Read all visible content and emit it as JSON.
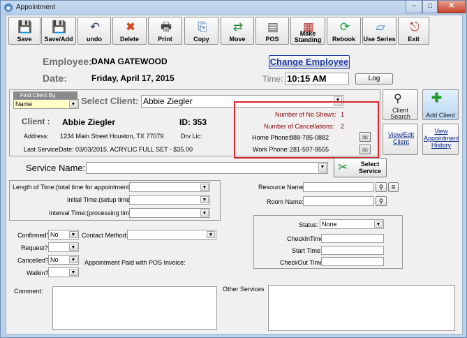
{
  "window": {
    "title": "Appointment"
  },
  "toolbar": [
    {
      "id": "save",
      "label": "Save",
      "icon": "floppy-icon",
      "glyph": "💾"
    },
    {
      "id": "save-add",
      "label": "Save/Add",
      "icon": "floppy-icon",
      "glyph": "💾"
    },
    {
      "id": "undo",
      "label": "undo",
      "icon": "undo-icon",
      "glyph": "↶"
    },
    {
      "id": "delete",
      "label": "Delete",
      "icon": "x-icon",
      "glyph": "✖"
    },
    {
      "id": "print",
      "label": "Print",
      "icon": "printer-icon",
      "glyph": "🖶"
    },
    {
      "id": "copy",
      "label": "Copy",
      "icon": "copy-icon",
      "glyph": "⎘"
    },
    {
      "id": "move",
      "label": "Move",
      "icon": "move-icon",
      "glyph": "⇄"
    },
    {
      "id": "pos",
      "label": "POS",
      "icon": "register-icon",
      "glyph": "▤"
    },
    {
      "id": "make-standing",
      "label": "Make Standing",
      "icon": "calendar-icon",
      "glyph": "▦"
    },
    {
      "id": "rebook",
      "label": "Rebook",
      "icon": "rebook-icon",
      "glyph": "⟳"
    },
    {
      "id": "use-series",
      "label": "Use Series",
      "icon": "series-icon",
      "glyph": "▱"
    },
    {
      "id": "exit",
      "label": "Exit",
      "icon": "exit-icon",
      "glyph": "⎋"
    }
  ],
  "header": {
    "employee_label": "Employee:",
    "employee_value": "DANA GATEWOOD",
    "date_label": "Date:",
    "date_value": "Friday, April 17, 2015",
    "change_employee": "Change Employee",
    "time_label": "Time:",
    "time_value": "10:15 AM",
    "log_label": "Log"
  },
  "client": {
    "find_by_label": "Find Client By:",
    "find_by_value": "Name",
    "select_client_label": "Select Client:",
    "select_client_value": "Abbie Ziegler",
    "client_label": "Client :",
    "client_name": "Abbie Ziegler",
    "id_label": "ID:",
    "id_value": "353",
    "address_label": "Address:",
    "address_value": "1234 Main Street Houston, TX 77079",
    "drv_lic_label": "Drv Lic:",
    "last_service_label": "Last Service:",
    "last_service_value": "Date: 03/03/2015, ACRYLIC FULL SET - $35.00",
    "no_shows_label": "Number of No Shows:",
    "no_shows_value": "1",
    "cancellations_label": "Number of Cancellations:",
    "cancellations_value": "2",
    "home_phone_label": "Home Phone:",
    "home_phone_value": "888-785-0882",
    "work_phone_label": "Work Phone:",
    "work_phone_value": "281-597-9555"
  },
  "side_buttons": {
    "client_search": "Client Search",
    "add_client": "Add Client",
    "view_edit_client": "View/Edit Client",
    "view_history": "View Appointment History"
  },
  "service": {
    "label": "Service Name:",
    "value": "",
    "select_service": "Select Service"
  },
  "times": {
    "length_label": "Length of Time:(total time for appointment)",
    "initial_label": "Initial Time:(setup time)",
    "interval_label": "Interval Time:(processing time)"
  },
  "resources": {
    "resource_label": "Resource Name:",
    "room_label": "Room Name:"
  },
  "flags": {
    "confirmed_label": "Confirmed?",
    "confirmed_value": "No",
    "contact_method_label": "Contact Method:",
    "request_label": "Request?",
    "cancelled_label": "Cancelled?",
    "cancelled_value": "No",
    "walkin_label": "Walkin?",
    "paid_pos_label": "Appointment Paid with POS Invoice:"
  },
  "status_panel": {
    "status_label": "Status:",
    "status_value": "None",
    "checkin_label": "CheckInTime:",
    "start_label": "Start Time:",
    "checkout_label": "CheckOut Time:"
  },
  "bottom": {
    "comment_label": "Comment:",
    "other_services_label": "Other Services"
  },
  "colors": {
    "highlight": "#d9242b",
    "accent_blue": "#1a3aa8",
    "dark_red": "#8b0000"
  }
}
